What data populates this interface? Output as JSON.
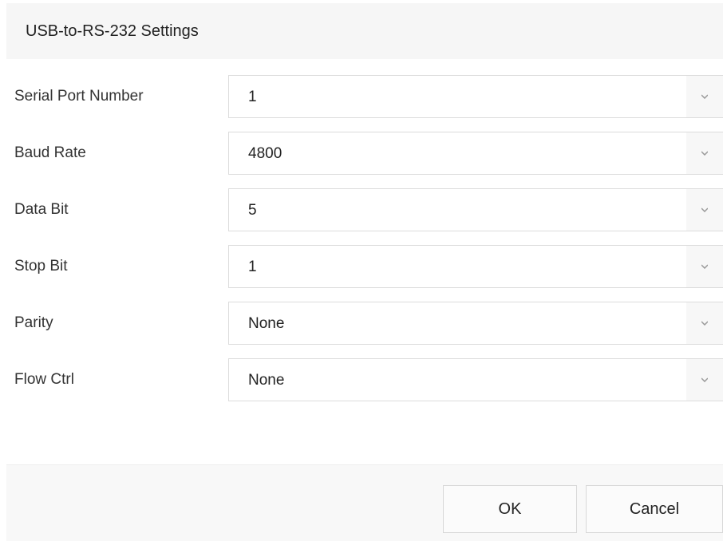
{
  "dialog": {
    "title": "USB-to-RS-232 Settings"
  },
  "fields": [
    {
      "label": "Serial Port Number",
      "value": "1"
    },
    {
      "label": "Baud Rate",
      "value": "4800"
    },
    {
      "label": "Data Bit",
      "value": "5"
    },
    {
      "label": "Stop Bit",
      "value": "1"
    },
    {
      "label": "Parity",
      "value": "None"
    },
    {
      "label": "Flow Ctrl",
      "value": "None"
    }
  ],
  "buttons": {
    "ok": "OK",
    "cancel": "Cancel"
  },
  "icons": {
    "dropdown": "chevron-down-icon"
  }
}
